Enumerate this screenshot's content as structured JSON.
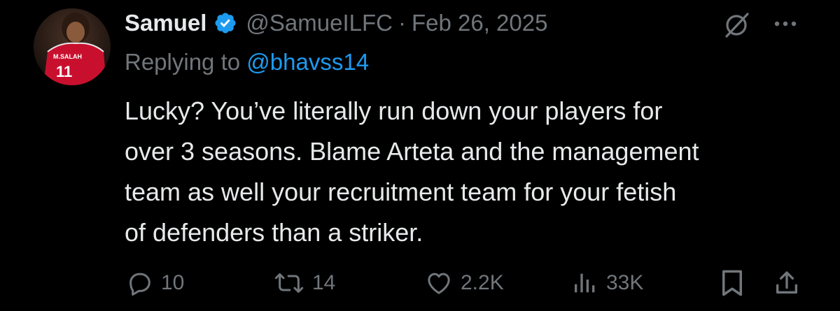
{
  "tweet": {
    "author_name": "Samuel",
    "handle": "@SamueILFC",
    "separator": "·",
    "date": "Feb 26, 2025",
    "replying_prefix": "Replying to",
    "replying_to": "@bhavss14",
    "text_lines": [
      "Lucky? You’ve literally run down your players for",
      "over 3 seasons. Blame Arteta and the management",
      "team as well your recruitment team for your fetish",
      "of defenders than a striker."
    ],
    "avatar_jersey": {
      "name": "M.SALAH",
      "number": "11"
    }
  },
  "actions": {
    "replies": "10",
    "reposts": "14",
    "likes": "2.2K",
    "views": "33K"
  },
  "icons": {
    "verified": "verified-badge-icon",
    "grok": "grok-icon",
    "more": "more-icon",
    "reply": "reply-icon",
    "repost": "repost-icon",
    "like": "heart-icon",
    "views": "views-icon",
    "bookmark": "bookmark-icon",
    "share": "share-icon"
  },
  "colors": {
    "background": "#000000",
    "text": "#e7e9ea",
    "secondary": "#71767b",
    "accent": "#1d9bf0",
    "jersey": "#c8102e"
  }
}
